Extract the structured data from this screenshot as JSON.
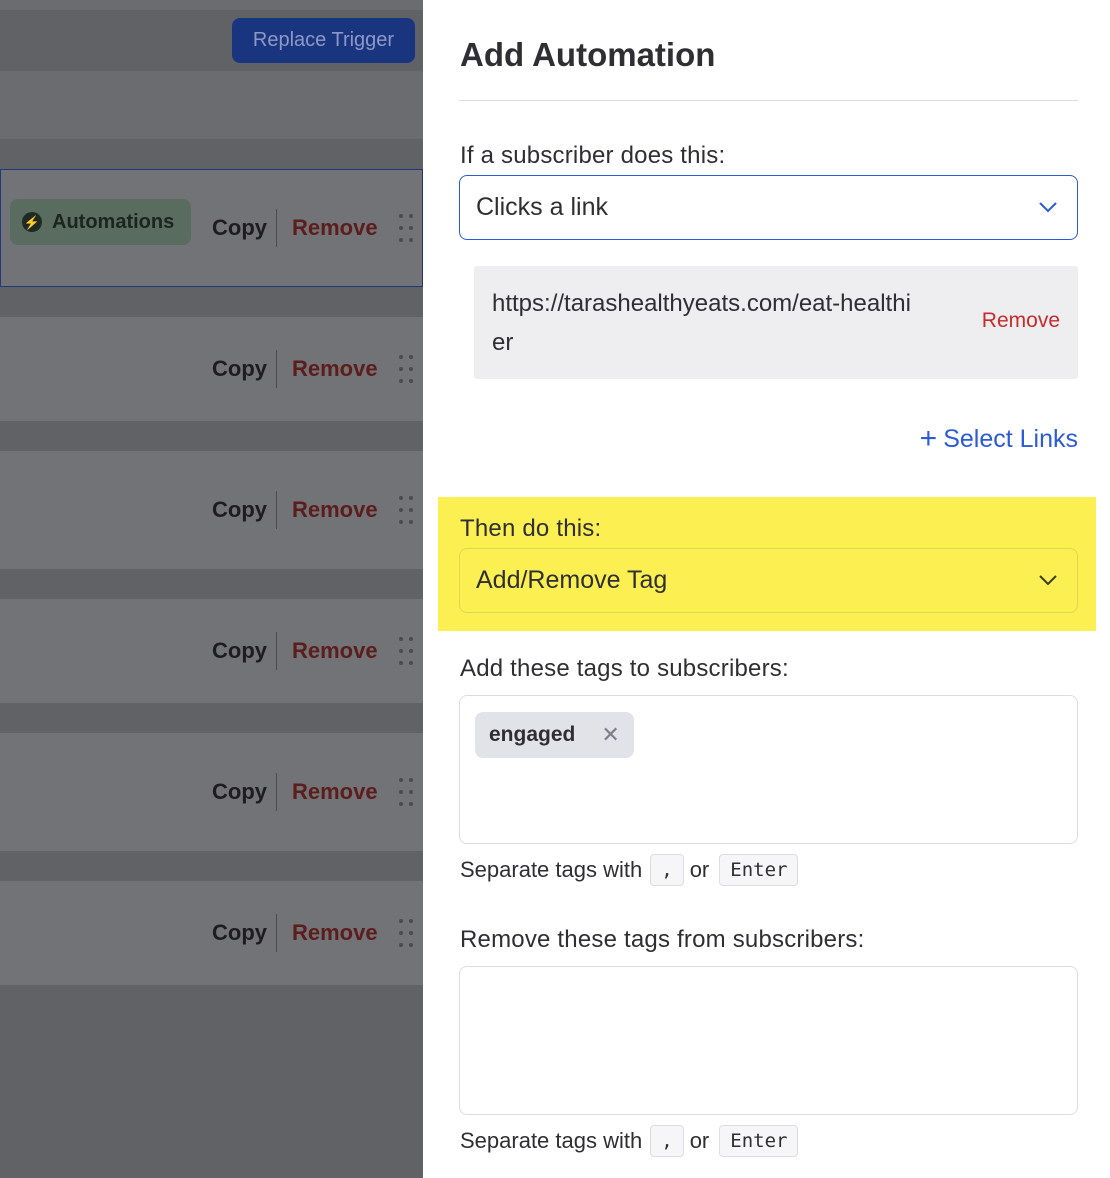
{
  "background": {
    "replace_trigger_label": "Replace Trigger",
    "automations_badge_label": "Automations",
    "rows": [
      {
        "copy_label": "Copy",
        "remove_label": "Remove"
      },
      {
        "copy_label": "Copy",
        "remove_label": "Remove"
      },
      {
        "copy_label": "Copy",
        "remove_label": "Remove"
      },
      {
        "copy_label": "Copy",
        "remove_label": "Remove"
      },
      {
        "copy_label": "Copy",
        "remove_label": "Remove"
      },
      {
        "copy_label": "Copy",
        "remove_label": "Remove"
      }
    ]
  },
  "drawer": {
    "title": "Add Automation",
    "trigger": {
      "label": "If a subscriber does this:",
      "selected": "Clicks a link",
      "link_url": "https://tarashealthyeats.com/eat-healthier",
      "link_remove_label": "Remove",
      "select_links_label": "Select Links",
      "select_links_icon": "plus-icon"
    },
    "action": {
      "label": "Then do this:",
      "selected": "Add/Remove Tag",
      "highlight_color": "#fbef51"
    },
    "add_tags": {
      "label": "Add these tags to subscribers:",
      "tags": [
        "engaged"
      ],
      "hint_prefix": "Separate tags with",
      "hint_key1": ",",
      "hint_or": "or",
      "hint_key2": "Enter"
    },
    "remove_tags": {
      "label": "Remove these tags from subscribers:",
      "tags": [],
      "hint_prefix": "Separate tags with",
      "hint_key1": ",",
      "hint_or": "or",
      "hint_key2": "Enter"
    }
  }
}
